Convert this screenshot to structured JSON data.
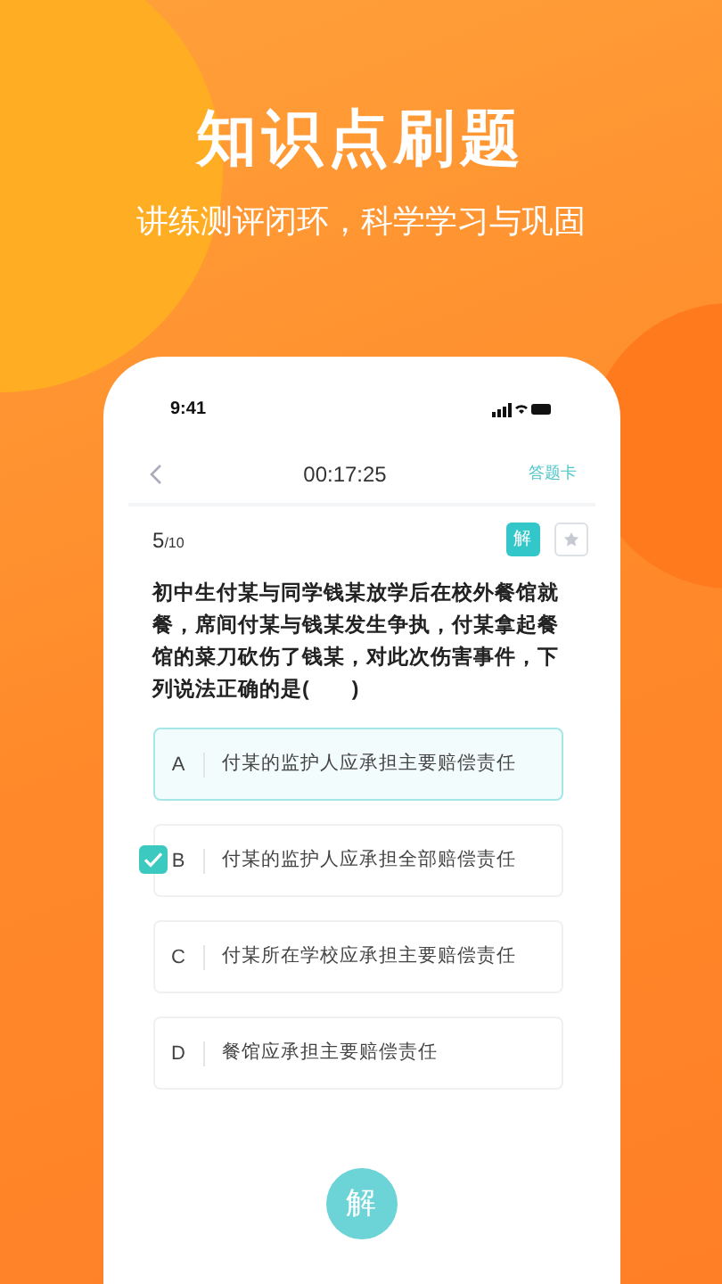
{
  "headline": "知识点刷题",
  "subheadline": "讲练测评闭环，科学学习与巩固",
  "status_bar": {
    "time": "9:41"
  },
  "nav": {
    "timer": "00:17:25",
    "answer_card": "答题卡"
  },
  "question": {
    "number": "5",
    "total": "/10",
    "explain_badge": "解",
    "starred": false,
    "text": "初中生付某与同学钱某放学后在校外餐馆就餐，席间付某与钱某发生争执，付某拿起餐馆的菜刀砍伤了钱某，对此次伤害事件，下列说法正确的是(　　)"
  },
  "options": [
    {
      "letter": "A",
      "text": "付某的监护人应承担主要赔偿责任",
      "selected": true,
      "checked": false
    },
    {
      "letter": "B",
      "text": "付某的监护人应承担全部赔偿责任",
      "selected": false,
      "checked": true
    },
    {
      "letter": "C",
      "text": "付某所在学校应承担主要赔偿责任",
      "selected": false,
      "checked": false
    },
    {
      "letter": "D",
      "text": "餐馆应承担主要赔偿责任",
      "selected": false,
      "checked": false
    }
  ],
  "solve_button": "解"
}
